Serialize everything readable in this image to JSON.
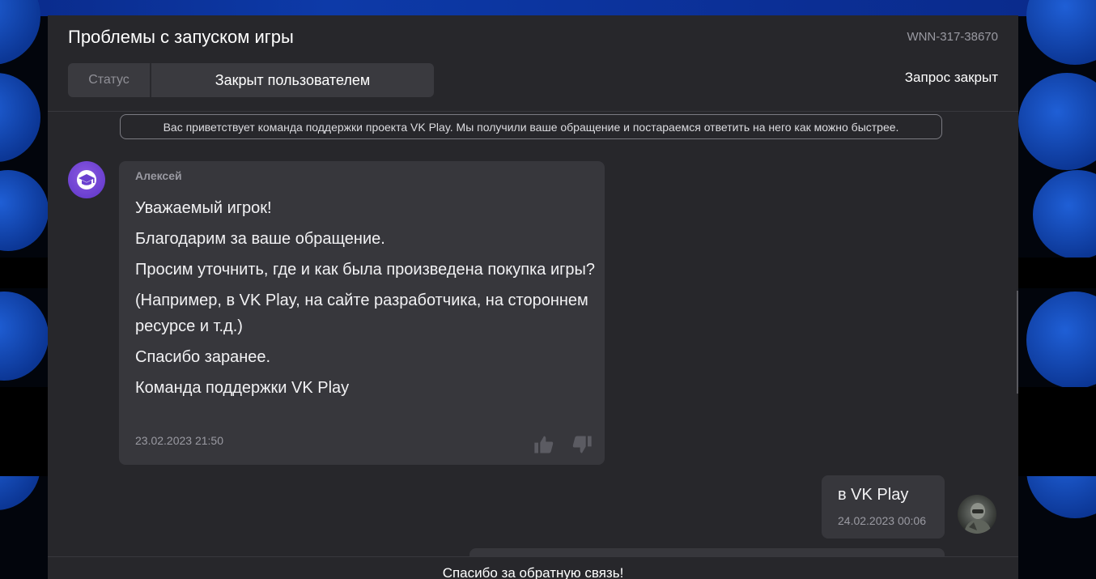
{
  "ticket": {
    "title": "Проблемы с запуском игры",
    "number": "WNN-317-38670",
    "status_label": "Статус",
    "status_value": "Закрыт пользователем",
    "closed_text": "Запрос закрыт"
  },
  "welcome_notice": "Вас приветствует команда поддержки проекта VK Play. Мы получили ваше обращение и постараемся ответить на него как можно быстрее.",
  "messages": [
    {
      "author": "Алексей",
      "lines": [
        "Уважаемый игрок!",
        "Благодарим за ваше обращение.",
        "Просим уточнить, где и как была произведена покупка игры?",
        "(Например, в VK Play, на сайте разработчика, на стороннем ресурсе и т.д.)",
        "Спасибо заранее.",
        "Команда поддержки VK Play"
      ],
      "time": "23.02.2023 21:50"
    },
    {
      "text": "в VK Play",
      "time": "24.02.2023 00:06"
    }
  ],
  "footer": {
    "text": "Спасибо за обратную связь!"
  },
  "icons": {
    "support_avatar": "graduation-cap-icon",
    "like": "thumbs-up-icon",
    "dislike": "thumbs-down-icon"
  },
  "colors": {
    "panel": "#27272b",
    "bubble": "#37373c",
    "avatar_purple": "#6a3fcf",
    "accent_blue": "#1f5fd6"
  }
}
